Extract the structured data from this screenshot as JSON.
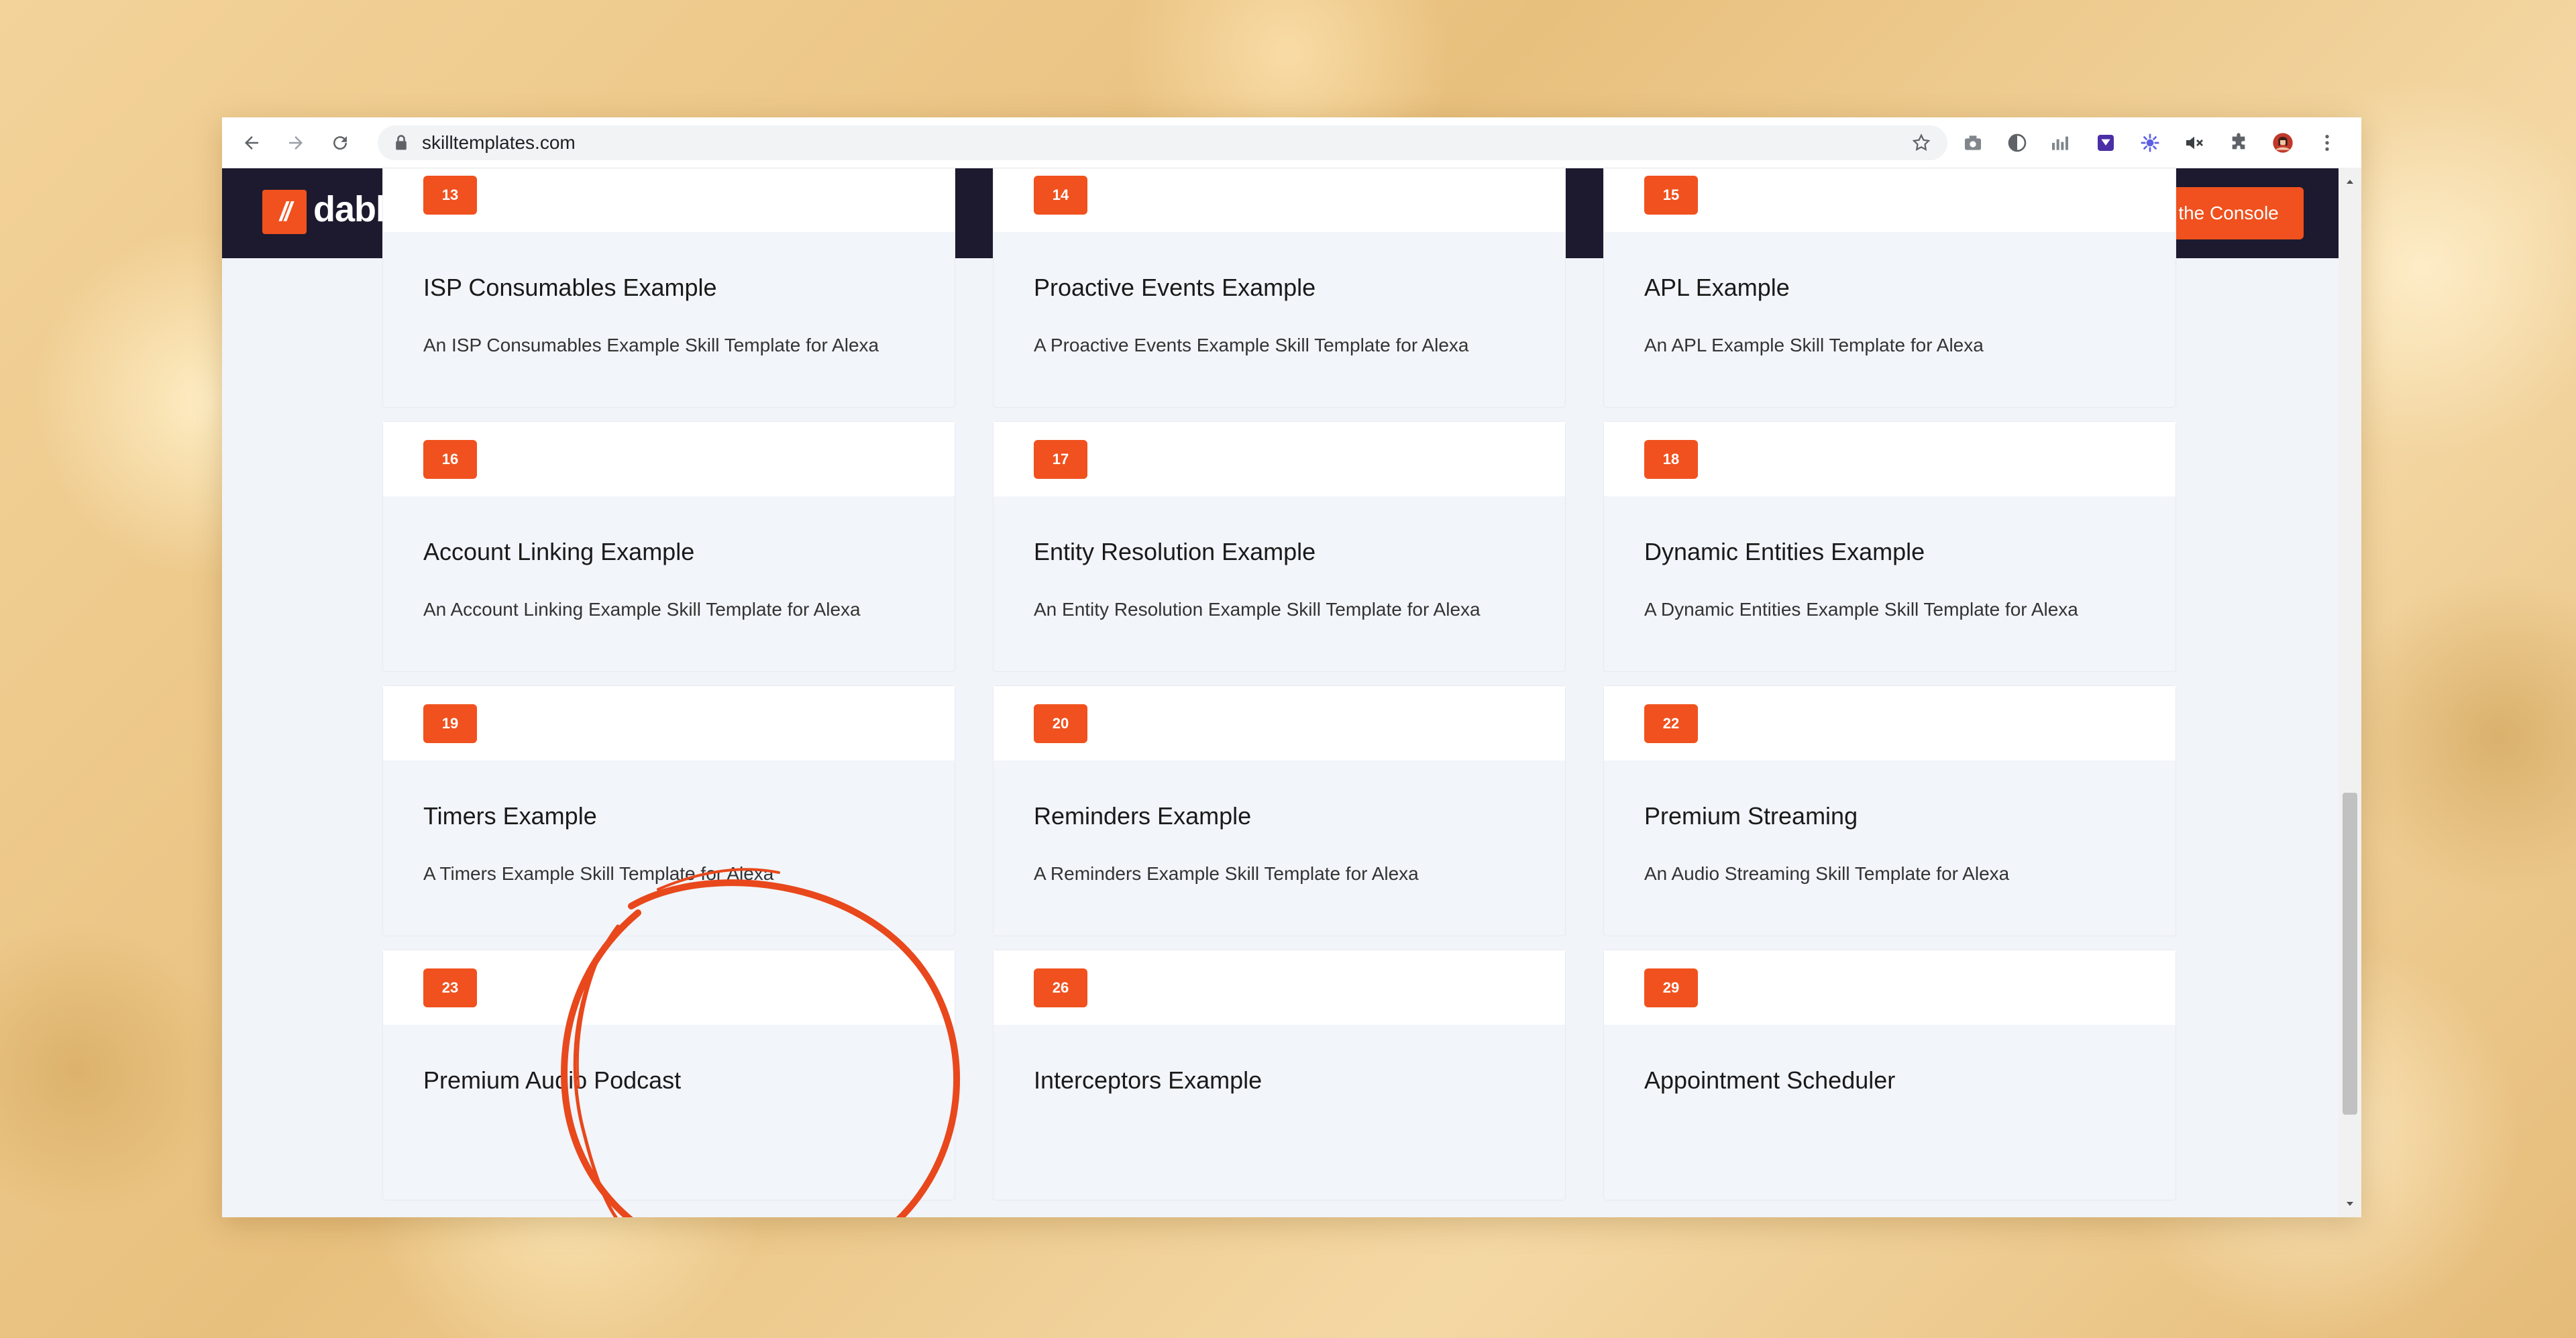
{
  "browser": {
    "url": "skilltemplates.com"
  },
  "site": {
    "logo_text": "dabble lab",
    "logo_mark": "//",
    "signin_label": "Sign In to the Console"
  },
  "cards": [
    {
      "num": "13",
      "title": "ISP Consumables Example",
      "desc": "An ISP Consumables Example Skill Template for Alexa"
    },
    {
      "num": "14",
      "title": "Proactive Events Example",
      "desc": "A Proactive Events Example Skill Template for Alexa"
    },
    {
      "num": "15",
      "title": "APL Example",
      "desc": "An APL Example Skill Template for Alexa"
    },
    {
      "num": "16",
      "title": "Account Linking Example",
      "desc": "An Account Linking Example Skill Template for Alexa"
    },
    {
      "num": "17",
      "title": "Entity Resolution Example",
      "desc": "An Entity Resolution Example Skill Template for Alexa"
    },
    {
      "num": "18",
      "title": "Dynamic Entities Example",
      "desc": "A Dynamic Entities Example Skill Template for Alexa"
    },
    {
      "num": "19",
      "title": "Timers Example",
      "desc": "A Timers Example Skill Template for Alexa"
    },
    {
      "num": "20",
      "title": "Reminders Example",
      "desc": "A Reminders Example Skill Template for Alexa"
    },
    {
      "num": "22",
      "title": "Premium Streaming",
      "desc": "An Audio Streaming Skill Template for Alexa"
    },
    {
      "num": "23",
      "title": "Premium Audio Podcast",
      "desc": ""
    },
    {
      "num": "26",
      "title": "Interceptors Example",
      "desc": ""
    },
    {
      "num": "29",
      "title": "Appointment Scheduler",
      "desc": ""
    }
  ],
  "colors": {
    "accent": "#f0511e",
    "header_bg": "#1d1a2f",
    "page_bg": "#f1f4f9"
  },
  "icons": [
    "back-icon",
    "forward-icon",
    "reload-icon",
    "lock-icon",
    "star-icon",
    "camera-icon",
    "moon-icon",
    "analytics-icon",
    "extension-square-icon",
    "gear-flower-icon",
    "mute-icon",
    "puzzle-icon",
    "profile-avatar",
    "more-menu-icon"
  ]
}
